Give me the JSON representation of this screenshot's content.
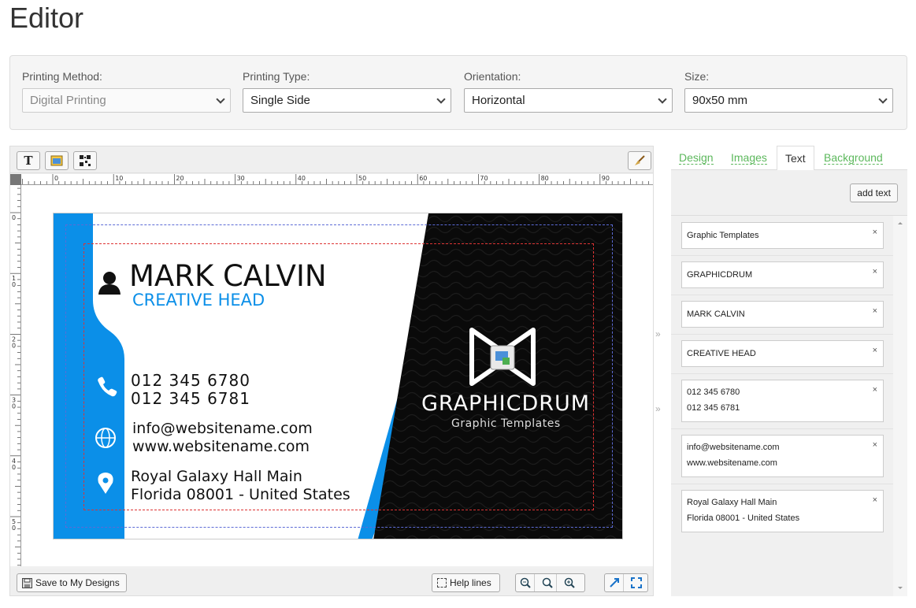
{
  "page": {
    "title": "Editor"
  },
  "options": [
    {
      "label": "Printing Method:",
      "value": "Digital Printing",
      "disabled": true
    },
    {
      "label": "Printing Type:",
      "value": "Single Side",
      "disabled": false
    },
    {
      "label": "Orientation:",
      "value": "Horizontal",
      "disabled": false
    },
    {
      "label": "Size:",
      "value": "90x50 mm",
      "disabled": false
    }
  ],
  "toolbar": {
    "text_tool_glyph": "T"
  },
  "ruler": {
    "top_labels": [
      "0",
      "10",
      "20",
      "30",
      "40",
      "50",
      "60",
      "70",
      "80",
      "90"
    ],
    "left_labels": [
      "0",
      "10",
      "20",
      "30",
      "40",
      "50"
    ]
  },
  "card": {
    "name": "MARK CALVIN",
    "title": "CREATIVE HEAD",
    "phone1": "012 345 6780",
    "phone2": "012 345 6781",
    "email": "info@websitename.com",
    "website": "www.websitename.com",
    "address1": "Royal Galaxy Hall Main",
    "address2": "Florida 08001 - United States",
    "brand": "GRAPHICDRUM",
    "tagline": "Graphic Templates",
    "colors": {
      "accent": "#0b8fe8",
      "dark": "#0a0a0a",
      "text": "#111111"
    }
  },
  "bottom": {
    "save_label": "Save to My Designs",
    "help_label": "Help lines"
  },
  "panel": {
    "tabs": [
      "Design",
      "Images",
      "Text",
      "Background"
    ],
    "active_tab": "Text",
    "add_text_label": "add text",
    "items": [
      {
        "lines": [
          "Graphic Templates"
        ]
      },
      {
        "lines": [
          "GRAPHICDRUM"
        ]
      },
      {
        "lines": [
          "MARK CALVIN"
        ]
      },
      {
        "lines": [
          "CREATIVE HEAD"
        ]
      },
      {
        "lines": [
          "012 345 6780",
          "012 345 6781"
        ]
      },
      {
        "lines": [
          "info@websitename.com",
          "www.websitename.com"
        ]
      },
      {
        "lines": [
          "Royal Galaxy Hall Main",
          "Florida 08001 - United States"
        ]
      }
    ],
    "remove_glyph": "×"
  },
  "splitter_glyph": "»"
}
